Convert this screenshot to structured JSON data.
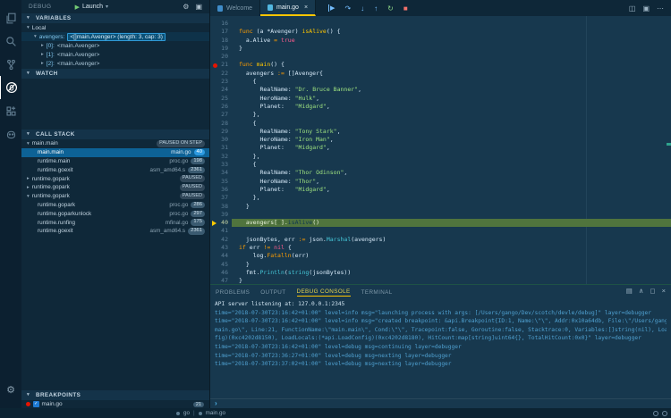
{
  "icons": {
    "play": "▶",
    "chevron_down": "▾",
    "chevron_expanded": "▾",
    "chevron_collapsed": "▸",
    "gear": "⚙",
    "console_box": "▣",
    "close": "×",
    "check": "✓",
    "prompt": "›"
  },
  "activity_bar": {
    "items": [
      "explorer-icon",
      "search-icon",
      "source-control-icon",
      "debug-icon",
      "extensions-icon",
      "gopher-icon"
    ],
    "active": "debug-icon",
    "settings": "⚙"
  },
  "sidebar": {
    "title": "DEBUG",
    "launch_label": "Launch",
    "sections": {
      "variables": {
        "header": "VARIABLES",
        "rows": [
          {
            "twisty": "▾",
            "label": "Local",
            "indent": 0
          },
          {
            "twisty": "▾",
            "name": "avengers:",
            "value": "<[]main.Avenger> (length: 3, cap: 3)",
            "indent": 1,
            "selected": true
          },
          {
            "twisty": "▸",
            "name": "[0]:",
            "value": "<main.Avenger>",
            "indent": 2
          },
          {
            "twisty": "▸",
            "name": "[1]:",
            "value": "<main.Avenger>",
            "indent": 2
          },
          {
            "twisty": "▸",
            "name": "[2]:",
            "value": "<main.Avenger>",
            "indent": 2
          }
        ]
      },
      "watch": {
        "header": "WATCH"
      },
      "call_stack": {
        "header": "CALL STACK",
        "frames": [
          {
            "label": "main.main",
            "badge": "PAUSED ON STEP",
            "twisty": "▾",
            "indent": 0
          },
          {
            "label": "main.main",
            "file": "main.go",
            "line": "40",
            "indent": 1,
            "selected": true
          },
          {
            "label": "runtime.main",
            "file": "proc.go",
            "line": "198",
            "indent": 1
          },
          {
            "label": "runtime.goexit",
            "file": "asm_amd64.s",
            "line": "2361",
            "indent": 1
          },
          {
            "label": "runtime.gopark",
            "badge": "PAUSED",
            "twisty": "▸",
            "indent": 0
          },
          {
            "label": "runtime.gopark",
            "badge": "PAUSED",
            "twisty": "▸",
            "indent": 0
          },
          {
            "label": "runtime.gopark",
            "badge": "PAUSED",
            "twisty": "▾",
            "indent": 0
          },
          {
            "label": "runtime.gopark",
            "file": "proc.go",
            "line": "286",
            "indent": 1
          },
          {
            "label": "runtime.goparkunlock",
            "file": "proc.go",
            "line": "297",
            "indent": 1
          },
          {
            "label": "runtime.runfing",
            "file": "mfinal.go",
            "line": "175",
            "indent": 1
          },
          {
            "label": "runtime.goexit",
            "file": "asm_amd64.s",
            "line": "2361",
            "indent": 1
          }
        ]
      },
      "breakpoints": {
        "header": "BREAKPOINTS",
        "items": [
          {
            "file": "main.go",
            "line": "21",
            "checked": true
          }
        ]
      }
    }
  },
  "editor": {
    "tabs": [
      {
        "label": "Welcome",
        "active": false
      },
      {
        "label": "main.go",
        "active": true
      }
    ],
    "debug_toolbar": [
      {
        "name": "continue-icon",
        "glyph": "▶",
        "cls": "blue cont"
      },
      {
        "name": "step-over-icon",
        "glyph": "↷",
        "cls": "blue"
      },
      {
        "name": "step-into-icon",
        "glyph": "↓",
        "cls": "blue"
      },
      {
        "name": "step-out-icon",
        "glyph": "↑",
        "cls": "blue"
      },
      {
        "name": "restart-icon",
        "glyph": "↻",
        "cls": "green"
      },
      {
        "name": "stop-icon",
        "glyph": "■",
        "cls": "red"
      }
    ],
    "right_icons": [
      {
        "name": "split-editor-icon",
        "glyph": "◫"
      },
      {
        "name": "editor-layout-icon",
        "glyph": "▣"
      },
      {
        "name": "more-actions-icon",
        "glyph": "⋯"
      }
    ],
    "code": {
      "lines": [
        {
          "n": 16,
          "segs": []
        },
        {
          "n": 17,
          "segs": [
            [
              "kw",
              "func "
            ],
            [
              "id",
              "(a *Avenger) "
            ],
            [
              "fn",
              "isAlive"
            ],
            [
              "id",
              "() {"
            ]
          ]
        },
        {
          "n": 18,
          "segs": [
            [
              "id",
              "  a.Alive "
            ],
            [
              "kw",
              "="
            ],
            [
              "id",
              " "
            ],
            [
              "bool",
              "true"
            ]
          ]
        },
        {
          "n": 19,
          "segs": [
            [
              "id",
              "}"
            ]
          ]
        },
        {
          "n": 20,
          "segs": []
        },
        {
          "n": 21,
          "bp": true,
          "segs": [
            [
              "kw",
              "func "
            ],
            [
              "fn",
              "main"
            ],
            [
              "id",
              "() {"
            ]
          ]
        },
        {
          "n": 22,
          "segs": [
            [
              "id",
              "  avengers "
            ],
            [
              "kw",
              ":="
            ],
            [
              "id",
              " []Avenger{"
            ]
          ]
        },
        {
          "n": 23,
          "segs": [
            [
              "id",
              "    {"
            ]
          ]
        },
        {
          "n": 24,
          "segs": [
            [
              "id",
              "      RealName: "
            ],
            [
              "str",
              "\"Dr. Bruce Banner\""
            ],
            [
              "id",
              ","
            ]
          ]
        },
        {
          "n": 25,
          "segs": [
            [
              "id",
              "      HeroName: "
            ],
            [
              "str",
              "\"Hulk\""
            ],
            [
              "id",
              ","
            ]
          ]
        },
        {
          "n": 26,
          "segs": [
            [
              "id",
              "      Planet:   "
            ],
            [
              "str",
              "\"Midgard\""
            ],
            [
              "id",
              ","
            ]
          ]
        },
        {
          "n": 27,
          "segs": [
            [
              "id",
              "    },"
            ]
          ]
        },
        {
          "n": 28,
          "segs": [
            [
              "id",
              "    {"
            ]
          ]
        },
        {
          "n": 29,
          "segs": [
            [
              "id",
              "      RealName: "
            ],
            [
              "str",
              "\"Tony Stark\""
            ],
            [
              "id",
              ","
            ]
          ]
        },
        {
          "n": 30,
          "segs": [
            [
              "id",
              "      HeroName: "
            ],
            [
              "str",
              "\"Iron Man\""
            ],
            [
              "id",
              ","
            ]
          ]
        },
        {
          "n": 31,
          "segs": [
            [
              "id",
              "      Planet:   "
            ],
            [
              "str",
              "\"Midgard\""
            ],
            [
              "id",
              ","
            ]
          ]
        },
        {
          "n": 32,
          "segs": [
            [
              "id",
              "    },"
            ]
          ]
        },
        {
          "n": 33,
          "segs": [
            [
              "id",
              "    {"
            ]
          ]
        },
        {
          "n": 34,
          "segs": [
            [
              "id",
              "      RealName: "
            ],
            [
              "str",
              "\"Thor Odinson\""
            ],
            [
              "id",
              ","
            ]
          ]
        },
        {
          "n": 35,
          "segs": [
            [
              "id",
              "      HeroName: "
            ],
            [
              "str",
              "\"Thor\""
            ],
            [
              "id",
              ","
            ]
          ]
        },
        {
          "n": 36,
          "segs": [
            [
              "id",
              "      Planet:   "
            ],
            [
              "str",
              "\"Midgard\""
            ],
            [
              "id",
              ","
            ]
          ]
        },
        {
          "n": 37,
          "segs": [
            [
              "id",
              "    },"
            ]
          ]
        },
        {
          "n": 38,
          "segs": [
            [
              "id",
              "  }"
            ]
          ]
        },
        {
          "n": 39,
          "segs": []
        },
        {
          "n": 40,
          "current": true,
          "segs": [
            [
              "cur",
              "  avengers["
            ],
            [
              "curdim",
              "0"
            ],
            [
              "cur",
              "]."
            ],
            [
              "curfn",
              "isAlive"
            ],
            [
              "cur",
              "()"
            ]
          ]
        },
        {
          "n": 41,
          "segs": []
        },
        {
          "n": 42,
          "segs": [
            [
              "id",
              "  jsonBytes, err "
            ],
            [
              "kw",
              ":="
            ],
            [
              "id",
              " json."
            ],
            [
              "bi",
              "Marshal"
            ],
            [
              "id",
              "(avengers)"
            ]
          ]
        },
        {
          "n": 43,
          "segs": [
            [
              "kw",
              "if"
            ],
            [
              "id",
              " err "
            ],
            [
              "kw",
              "!="
            ],
            [
              "id",
              " "
            ],
            [
              "bool",
              "nil"
            ],
            [
              "id",
              " {"
            ]
          ]
        },
        {
          "n": 44,
          "segs": [
            [
              "id",
              "    log."
            ],
            [
              "kw",
              "Fatalln"
            ],
            [
              "id",
              "(err)"
            ]
          ]
        },
        {
          "n": 45,
          "segs": [
            [
              "id",
              "  }"
            ]
          ]
        },
        {
          "n": 46,
          "segs": [
            [
              "id",
              "  fmt."
            ],
            [
              "bi",
              "Println"
            ],
            [
              "id",
              "("
            ],
            [
              "bi",
              "string"
            ],
            [
              "id",
              "(jsonBytes))"
            ]
          ]
        },
        {
          "n": 47,
          "segs": [
            [
              "id",
              "}"
            ]
          ]
        }
      ]
    }
  },
  "panel": {
    "tabs": [
      "PROBLEMS",
      "OUTPUT",
      "DEBUG CONSOLE",
      "TERMINAL"
    ],
    "active_tab": "DEBUG CONSOLE",
    "right_icons": [
      {
        "name": "clear-console-icon",
        "glyph": "▤"
      },
      {
        "name": "maximize-panel-icon",
        "glyph": "∧"
      },
      {
        "name": "restore-panel-icon",
        "glyph": "◻"
      },
      {
        "name": "close-panel-icon",
        "glyph": "×"
      }
    ],
    "console_lines": [
      {
        "c": "plain",
        "t": "API server listening at: 127.0.0.1:2345"
      },
      {
        "c": "log",
        "t": "time=\"2018-07-30T23:16:42+01:00\" level=info msg=\"launching process with args: [/Users/gango/Dev/scotch/devle/debug]\" layer=debugger"
      },
      {
        "c": "log",
        "t": "time=\"2018-07-30T23:16:42+01:00\" level=info msg=\"created breakpoint: &api.Breakpoint{ID:1, Name:\\\"\\\", Addr:0x10a64db, File:\\\"/Users/gango/Dev/scotch/devle/"
      },
      {
        "c": "log",
        "t": "main.go\\\", Line:21, FunctionName:\\\"main.main\\\", Cond:\\\"\\\", Tracepoint:false, Goroutine:false, Stacktrace:0, Variables:[]string(nil), LoadArgs:(*api.LoadCon"
      },
      {
        "c": "log",
        "t": "fig)(0xc4202d8150), LoadLocals:(*api.LoadConfig)(0xc4202d8180), HitCount:map[string]uint64{}, TotalHitCount:0x0}\" layer=debugger"
      },
      {
        "c": "log",
        "t": "time=\"2018-07-30T23:16:42+01:00\" level=debug msg=continuing layer=debugger"
      },
      {
        "c": "log",
        "t": "time=\"2018-07-30T23:36:27+01:00\" level=debug msg=nexting layer=debugger"
      },
      {
        "c": "log",
        "t": "time=\"2018-07-30T23:37:02+01:00\" level=debug msg=nexting layer=debugger"
      }
    ],
    "prompt": "›"
  },
  "status_bar": {
    "items": [
      {
        "label": "go"
      },
      {
        "label": "main.go"
      }
    ],
    "separator": "|"
  },
  "colors": {
    "accent_gold": "#ffc600",
    "breakpoint_red": "#e51400",
    "current_line_green": "#50743d",
    "selection_blue": "#0d6296",
    "editor_bg": "#17384e",
    "restart_green": "#89d185",
    "stop_red": "#f4726b"
  }
}
